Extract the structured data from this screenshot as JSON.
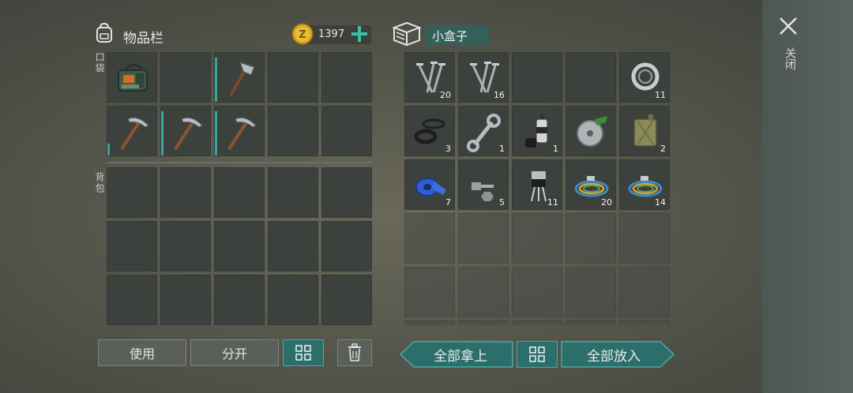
{
  "inventory": {
    "title": "物品栏",
    "coins": "1397",
    "pocket_label": "口袋",
    "backpack_label": "背包",
    "pocket_items": [
      {
        "icon": "military-bag-icon",
        "qty": "",
        "bar": 0
      },
      {
        "icon": "",
        "qty": "",
        "bar": 0
      },
      {
        "icon": "hatchet-icon",
        "qty": "",
        "bar": 0.9
      },
      {
        "icon": "",
        "qty": "",
        "bar": 0
      },
      {
        "icon": "",
        "qty": "",
        "bar": 0
      },
      {
        "icon": "pickaxe-icon",
        "qty": "",
        "bar": 0.25
      },
      {
        "icon": "pickaxe-icon",
        "qty": "",
        "bar": 0.9
      },
      {
        "icon": "pickaxe-icon",
        "qty": "",
        "bar": 0.9
      },
      {
        "icon": "",
        "qty": "",
        "bar": 0
      },
      {
        "icon": "",
        "qty": "",
        "bar": 0
      }
    ]
  },
  "container": {
    "name": "小盒子",
    "items": [
      {
        "icon": "nails-icon",
        "qty": "20"
      },
      {
        "icon": "nails-icon",
        "qty": "16"
      },
      {
        "icon": "",
        "qty": ""
      },
      {
        "icon": "",
        "qty": ""
      },
      {
        "icon": "bearing-icon",
        "qty": "11"
      },
      {
        "icon": "rubber-parts-icon",
        "qty": "3"
      },
      {
        "icon": "wrench-icon",
        "qty": "1"
      },
      {
        "icon": "spray-can-icon",
        "qty": "1"
      },
      {
        "icon": "saw-blade-icon",
        "qty": ""
      },
      {
        "icon": "jerrycan-icon",
        "qty": "2"
      },
      {
        "icon": "tape-icon",
        "qty": "7"
      },
      {
        "icon": "bolts-icon",
        "qty": "5"
      },
      {
        "icon": "transistor-icon",
        "qty": "11"
      },
      {
        "icon": "wires-icon",
        "qty": "20"
      },
      {
        "icon": "wires-icon",
        "qty": "14"
      }
    ]
  },
  "buttons": {
    "use": "使用",
    "split": "分开",
    "take_all": "全部拿上",
    "put_all": "全部放入"
  },
  "close_label": "关闭",
  "colors": {
    "accent": "#2c6f6a",
    "accent_light": "#4da9a2",
    "coin": "#d8a623"
  }
}
